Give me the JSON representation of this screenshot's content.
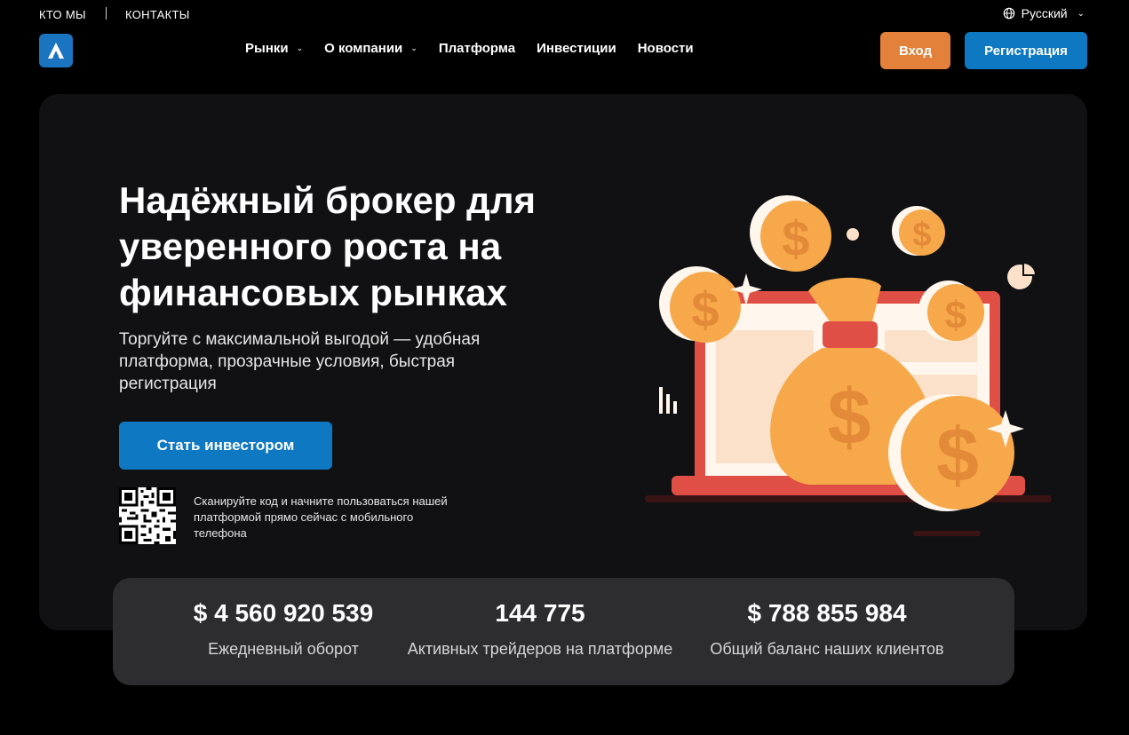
{
  "topbar": {
    "about": "КТО МЫ",
    "contacts": "КОНТАКТЫ",
    "language": "Русский"
  },
  "nav": {
    "items": [
      {
        "label": "Рынки",
        "dropdown": true
      },
      {
        "label": "О компании",
        "dropdown": true
      },
      {
        "label": "Платформа",
        "dropdown": false
      },
      {
        "label": "Инвестиции",
        "dropdown": false
      },
      {
        "label": "Новости",
        "dropdown": false
      }
    ],
    "login": "Вход",
    "register": "Регистрация"
  },
  "hero": {
    "title": "Надёжный брокер для уверенного роста на финансовых рынках",
    "subtitle": "Торгуйте с максимальной выгодой — удобная платформа, прозрачные условия, быстрая регистрация",
    "cta": "Стать инвестором",
    "qr_text": "Сканируйте код и начните пользоваться нашей платформой прямо сейчас с мобильного телефона"
  },
  "stats": [
    {
      "value": "$ 4 560 920 539",
      "label": "Ежедневный оборот"
    },
    {
      "value": "144 775",
      "label": "Активных трейдеров на платформе"
    },
    {
      "value": "$ 788 855 984",
      "label": "Общий баланс наших клиентов"
    }
  ],
  "colors": {
    "login": "#e3813a",
    "primary": "#0f78c2",
    "hero_bg": "#111113",
    "stats_bg": "#2d2d2f",
    "coin": "#f6a84a",
    "laptop": "#e04f45"
  }
}
